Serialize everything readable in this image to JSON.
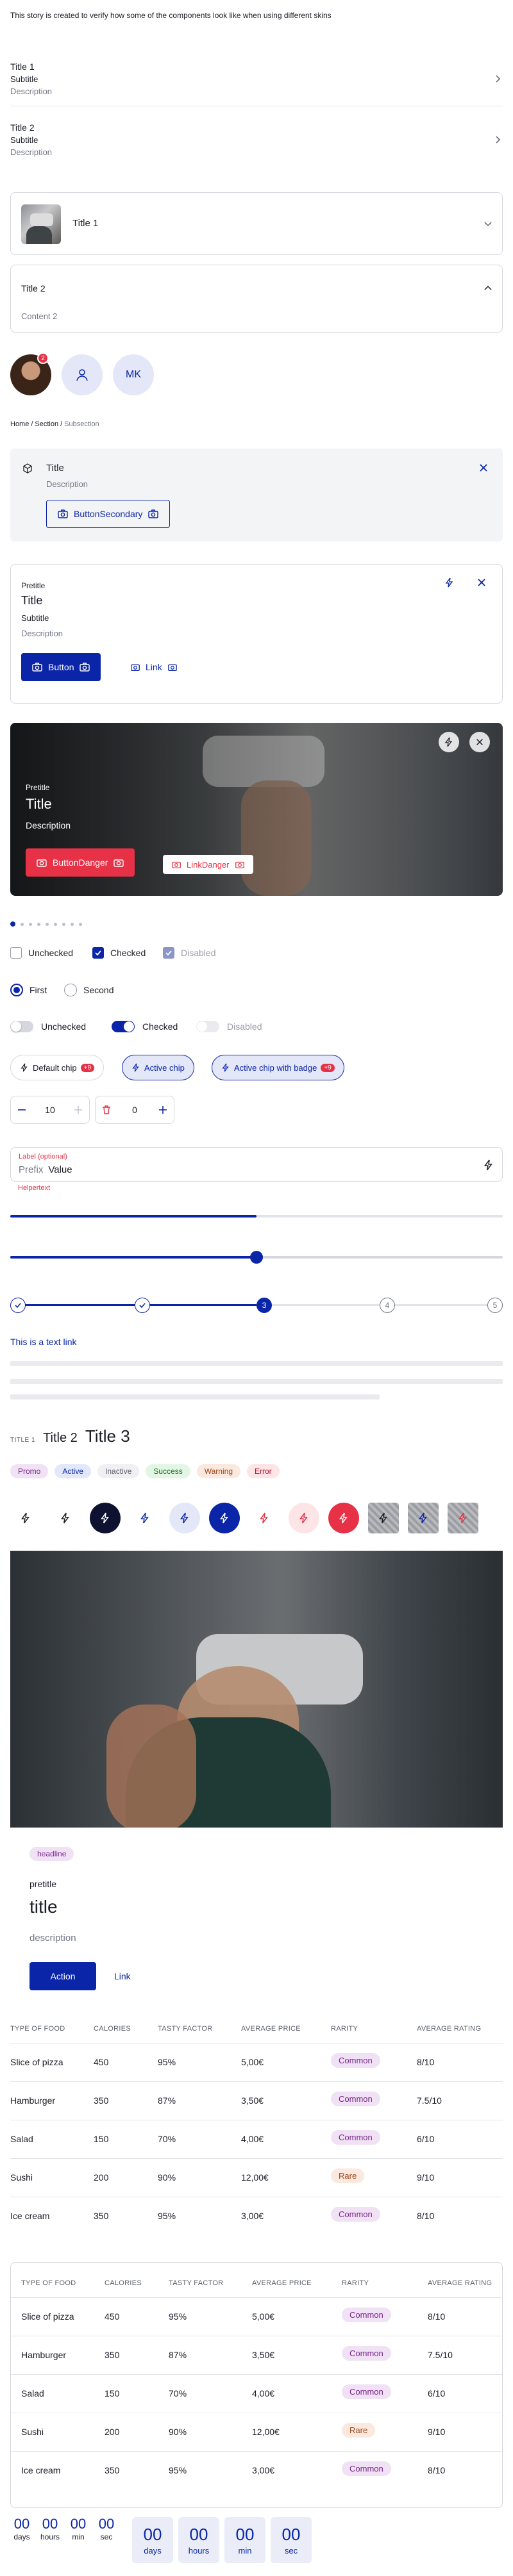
{
  "intro": "This story is created to verify how some of the components look like when using different skins",
  "list_items": [
    {
      "title": "Title 1",
      "subtitle": "Subtitle",
      "description": "Description"
    },
    {
      "title": "Title 2",
      "subtitle": "Subtitle",
      "description": "Description"
    }
  ],
  "accordion": {
    "item1_title": "Title 1",
    "item2_title": "Title 2",
    "item2_content": "Content 2"
  },
  "avatars": {
    "initials": "MK",
    "badge_count": "2"
  },
  "breadcrumbs": [
    "Home",
    "Section",
    "Subsection"
  ],
  "callout": {
    "title": "Title",
    "description": "Description",
    "button": "ButtonSecondary"
  },
  "promo_card": {
    "pretitle": "Pretitle",
    "title": "Title",
    "subtitle": "Subtitle",
    "description": "Description",
    "button": "Button",
    "link": "Link"
  },
  "media_card": {
    "pretitle": "Pretitle",
    "title": "Title",
    "description": "Description",
    "button": "ButtonDanger",
    "link": "LinkDanger"
  },
  "checkboxes": [
    {
      "label": "Unchecked",
      "checked": false
    },
    {
      "label": "Checked",
      "checked": true
    },
    {
      "label": "Disabled",
      "checked": true,
      "disabled": true
    }
  ],
  "radios": [
    {
      "label": "First",
      "checked": true
    },
    {
      "label": "Second",
      "checked": false
    }
  ],
  "switches": [
    {
      "label": "Unchecked",
      "on": false
    },
    {
      "label": "Checked",
      "on": true
    },
    {
      "label": "Disabled",
      "on": false,
      "disabled": true
    }
  ],
  "chips": [
    {
      "label": "Default chip",
      "badge": "+9"
    },
    {
      "label": "Active chip"
    },
    {
      "label": "Active chip with badge",
      "badge": "+9"
    }
  ],
  "steppers": [
    {
      "value": "10"
    },
    {
      "value": "0"
    }
  ],
  "text_field": {
    "label": "Label (optional)",
    "prefix": "Prefix",
    "value": "Value",
    "helper": "Helpertext"
  },
  "progress": 0.5,
  "slider": 0.5,
  "step_indicator": {
    "steps": [
      "1",
      "2",
      "3",
      "4",
      "5"
    ],
    "current": 3
  },
  "text_link": "This is a text link",
  "titles": {
    "t1": "TITLE 1",
    "t2": "Title 2",
    "t3": "Title 3"
  },
  "tags": [
    {
      "label": "Promo",
      "bg": "#f1e1f4",
      "fg": "#76268a"
    },
    {
      "label": "Active",
      "bg": "#e2e7fb",
      "fg": "#0b25a8"
    },
    {
      "label": "Inactive",
      "bg": "#f0f0f2",
      "fg": "#5b5e6b"
    },
    {
      "label": "Success",
      "bg": "#e3f6e3",
      "fg": "#1c6c2b"
    },
    {
      "label": "Warning",
      "bg": "#fbe8de",
      "fg": "#9a4a1a"
    },
    {
      "label": "Error",
      "bg": "#fde4e6",
      "fg": "#b41c30"
    }
  ],
  "hero_card": {
    "headline": "headline",
    "pretitle": "pretitle",
    "title": "title",
    "description": "description",
    "button": "Action",
    "link": "Link"
  },
  "table": {
    "headers": [
      "TYPE OF FOOD",
      "CALORIES",
      "TASTY FACTOR",
      "AVERAGE PRICE",
      "RARITY",
      "AVERAGE RATING"
    ],
    "rows": [
      [
        "Slice of pizza",
        "450",
        "95%",
        "5,00€",
        "Common",
        "8/10"
      ],
      [
        "Hamburger",
        "350",
        "87%",
        "3,50€",
        "Common",
        "7.5/10"
      ],
      [
        "Salad",
        "150",
        "70%",
        "4,00€",
        "Common",
        "6/10"
      ],
      [
        "Sushi",
        "200",
        "90%",
        "12,00€",
        "Rare",
        "9/10"
      ],
      [
        "Ice cream",
        "350",
        "95%",
        "3,00€",
        "Common",
        "8/10"
      ]
    ]
  },
  "countdown": {
    "values": [
      "00",
      "00",
      "00",
      "00"
    ],
    "labels_small": [
      "days",
      "hours",
      "min",
      "sec"
    ],
    "labels_boxed": [
      "days",
      "hours",
      "min",
      "sec"
    ]
  },
  "colors": {
    "brand": "#0b25a8",
    "danger": "#e63146"
  }
}
